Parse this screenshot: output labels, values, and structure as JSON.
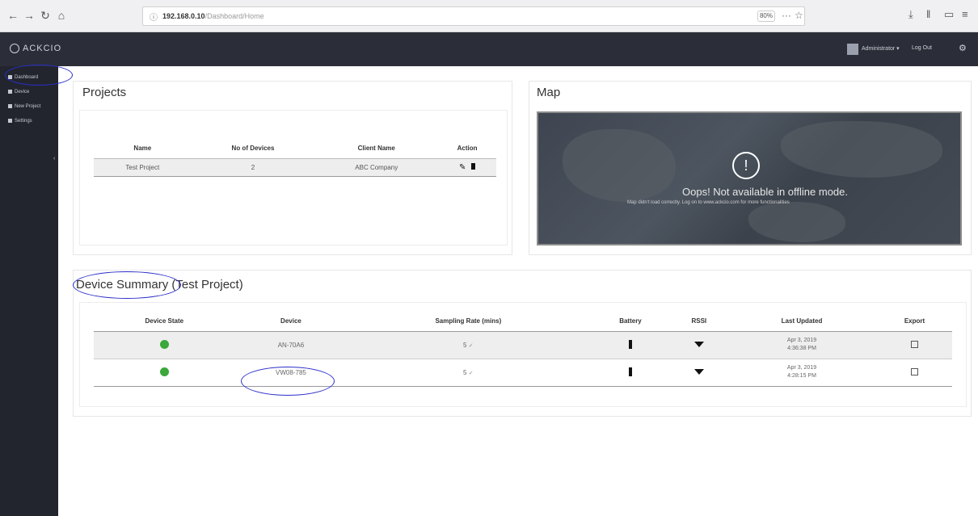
{
  "browser": {
    "url_host": "192.168.0.10",
    "url_path": "/Dashboard/Home",
    "zoom": "80%"
  },
  "app": {
    "brand": "ACKCIO",
    "admin_menu": "Administrator ▾",
    "logout": "Log Out",
    "gear": "⚙"
  },
  "sidebar": {
    "items": [
      {
        "label": "Dashboard"
      },
      {
        "label": "Device"
      },
      {
        "label": "New Project"
      },
      {
        "label": "Settings"
      }
    ]
  },
  "projects": {
    "title": "Projects",
    "headers": [
      "Name",
      "No of Devices",
      "Client Name",
      "Action"
    ],
    "rows": [
      {
        "name": "Test Project",
        "devices": "2",
        "client": "ABC Company"
      }
    ]
  },
  "map": {
    "title": "Map",
    "message": "Oops! Not available in offline mode.",
    "sub_message": "Map didn't load correctly. Log on to www.ackcio.com for more functionalities"
  },
  "device_summary": {
    "title": "Device Summary (Test Project)",
    "headers": [
      "Device State",
      "Device",
      "Sampling Rate (mins)",
      "Battery",
      "RSSI",
      "Last Updated",
      "Export"
    ],
    "rows": [
      {
        "device": "AN-70A6",
        "sampling": "5",
        "date": "Apr 3, 2019",
        "time": "4:36:38 PM"
      },
      {
        "device": "VW08-785",
        "sampling": "5",
        "date": "Apr 3, 2019",
        "time": "4:28:15 PM"
      }
    ]
  },
  "colors": {
    "header_bg": "#2b2e38",
    "sidebar_bg": "#22252e",
    "status_ok": "#3aa83a",
    "annotation": "#2b2fc9"
  }
}
